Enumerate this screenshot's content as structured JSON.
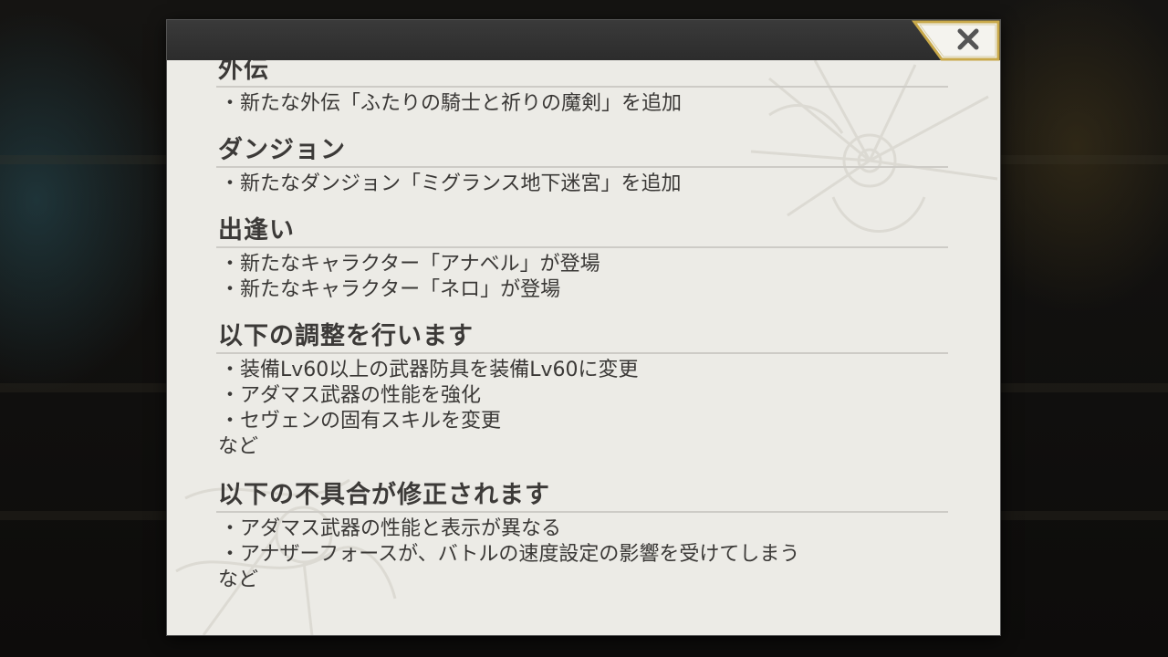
{
  "dialog": {
    "close_icon": "close-x-icon",
    "colors": {
      "header": "#2f2f2f",
      "panel": "#ecebe6",
      "accent_gold": "#c9a94a"
    },
    "sections": [
      {
        "title": "外伝",
        "items": [
          "・新たな外伝「ふたりの騎士と祈りの魔剣」を追加"
        ]
      },
      {
        "title": "ダンジョン",
        "items": [
          "・新たなダンジョン「ミグランス地下迷宮」を追加"
        ]
      },
      {
        "title": "出逢い",
        "items": [
          "・新たなキャラクター「アナベル」が登場",
          "・新たなキャラクター「ネロ」が登場"
        ]
      },
      {
        "title": "以下の調整を行います",
        "items": [
          "・装備Lv60以上の武器防具を装備Lv60に変更",
          "・アダマス武器の性能を強化",
          "・セヴェンの固有スキルを変更"
        ],
        "note": "など"
      },
      {
        "title": "以下の不具合が修正されます",
        "items": [
          "・アダマス武器の性能と表示が異なる",
          "・アナザーフォースが、バトルの速度設定の影響を受けてしまう"
        ],
        "note": "など"
      }
    ]
  }
}
